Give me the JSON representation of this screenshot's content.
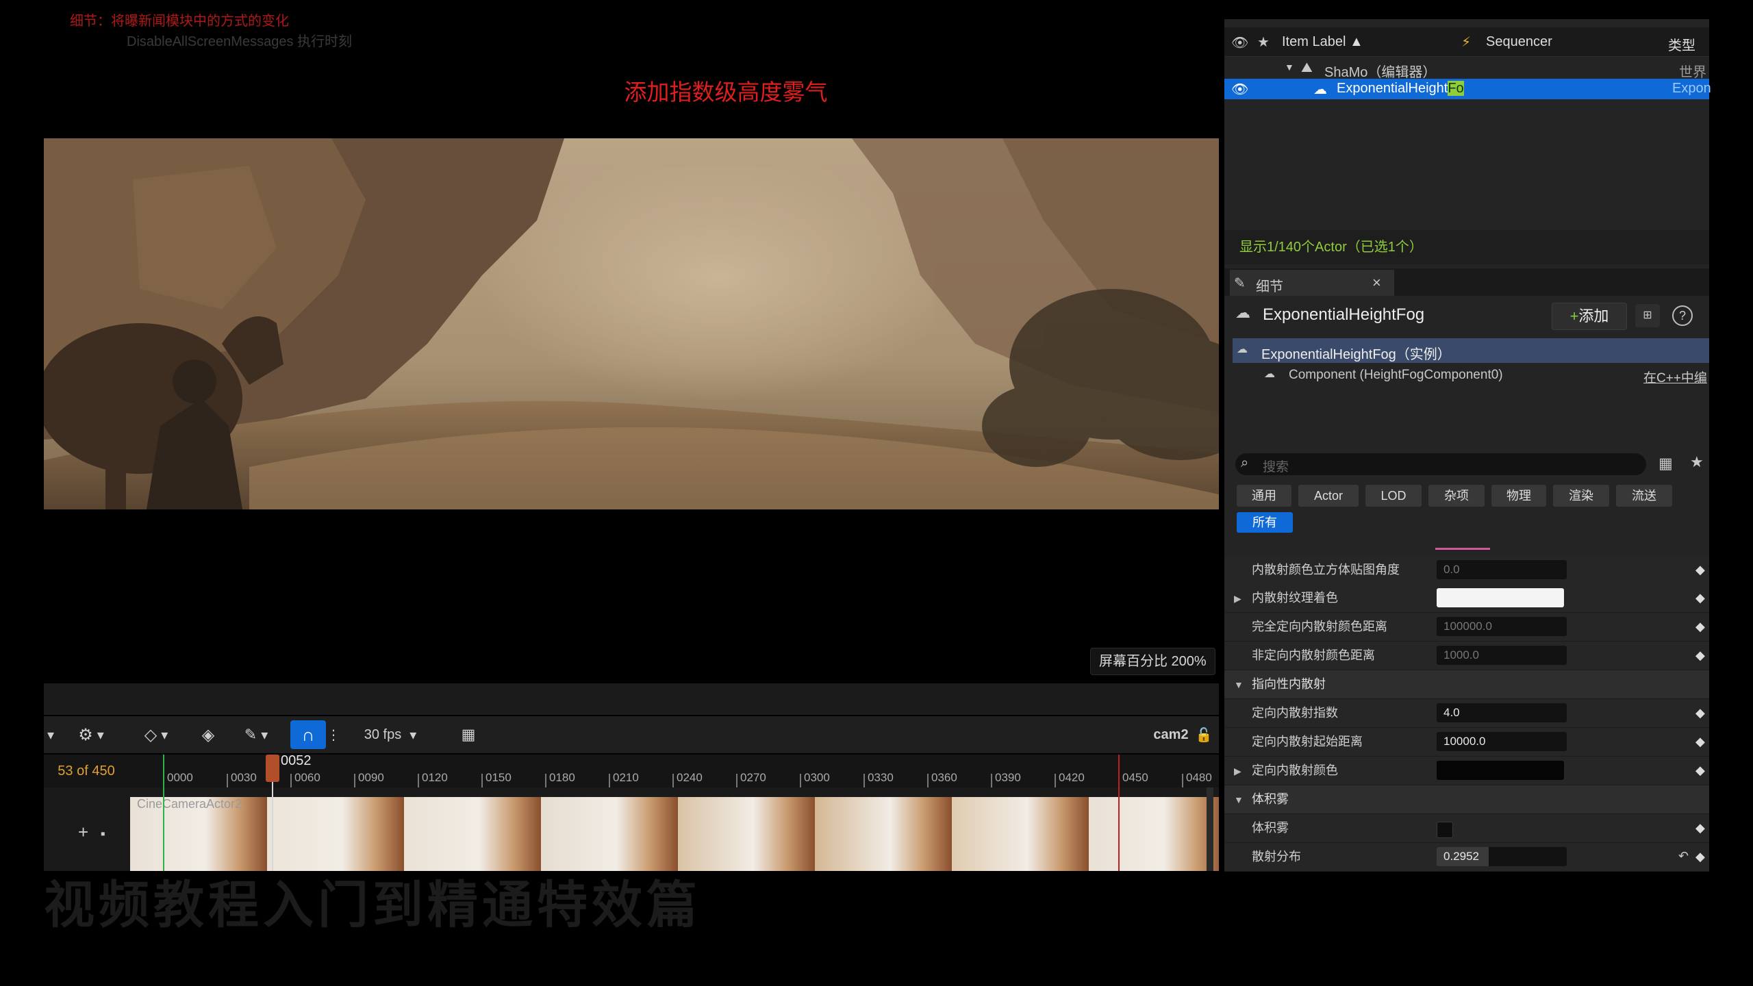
{
  "overlay": {
    "caption_red": "细节：将曝新闻模块中的方式的变化",
    "caption_gray": "DisableAllScreenMessages 执行时刻",
    "headline": "添加指数级高度雾气",
    "bottom_ghost": "视频教程入门到精通特效篇"
  },
  "viewport": {
    "scale_label": "屏幕百分比  200%"
  },
  "sequencer": {
    "fps": "30 fps",
    "camera": "cam2",
    "frame_count": "53 of 450",
    "playhead": "0052",
    "track_label": "CineCameraActor2",
    "ticks": [
      "0000",
      "0030",
      "0060",
      "0090",
      "0120",
      "0150",
      "0180",
      "0210",
      "0240",
      "0270",
      "0300",
      "0330",
      "0360",
      "0390",
      "0420",
      "0450",
      "0480"
    ]
  },
  "outliner": {
    "col_label": "Item Label ▲",
    "col_sequencer": "Sequencer",
    "col_type": "类型",
    "root_item": "ShaMo（编辑器）",
    "root_type": "世界场",
    "selected_item_prefix": "ExponentialHeight",
    "selected_item_highlight": "Fo",
    "selected_type": "Expon",
    "status": "显示1/140个Actor（已选1个）"
  },
  "details": {
    "tab_title": "细节",
    "actor_name": "ExponentialHeightFog",
    "add_button": "添加",
    "instance_row": "ExponentialHeightFog（实例）",
    "component_row": "Component (HeightFogComponent0)",
    "cpp_link": "在C++中编",
    "search_placeholder": "搜索",
    "filters": [
      "通用",
      "Actor",
      "LOD",
      "杂项",
      "物理",
      "渲染",
      "流送"
    ],
    "filter_all": "所有",
    "properties": [
      {
        "label": "内散射颜色立方体贴图角度",
        "value": "0.0"
      },
      {
        "label": "内散射纹理着色",
        "value": ""
      },
      {
        "label": "完全定向内散射颜色距离",
        "value": "100000.0"
      },
      {
        "label": "非定向内散射颜色距离",
        "value": "1000.0"
      }
    ],
    "section_directional": "指向性内散射",
    "dir_props": [
      {
        "label": "定向内散射指数",
        "value": "4.0"
      },
      {
        "label": "定向内散射起始距离",
        "value": "10000.0"
      },
      {
        "label": "定向内散射颜色",
        "value": ""
      }
    ],
    "section_volumetric": "体积雾",
    "vol_props": [
      {
        "label": "体积雾",
        "value": ""
      },
      {
        "label": "散射分布",
        "value": "0.2952"
      }
    ]
  },
  "colors": {
    "accent": "#0f6ad8",
    "headline": "#e01e1e",
    "status_green": "#8fce3a",
    "frame_orange": "#e0a030"
  }
}
